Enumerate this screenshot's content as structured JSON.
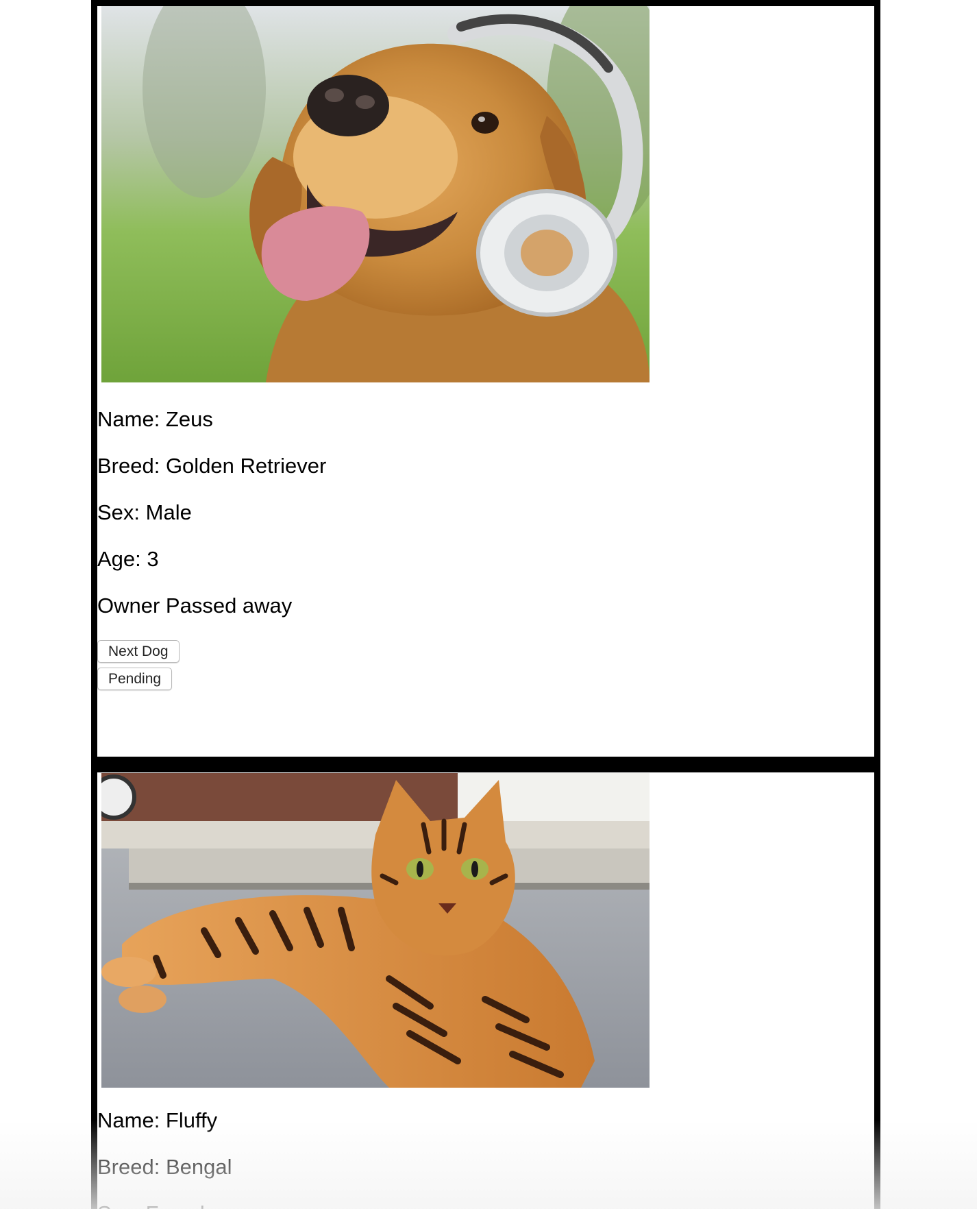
{
  "pets": [
    {
      "kind": "dog",
      "image_label": "golden retriever wearing headphones",
      "name_line": "Name: Zeus",
      "breed_line": "Breed: Golden Retriever",
      "sex_line": "Sex: Male",
      "age_line": "Age: 3",
      "story_line": "Owner Passed away",
      "buttons": {
        "next": "Next Dog",
        "pending": "Pending"
      }
    },
    {
      "kind": "cat",
      "image_label": "bengal cat lying on pavement",
      "name_line": "Name: Fluffy",
      "breed_line": "Breed: Bengal",
      "sex_line": "Sex: Female"
    }
  ],
  "colors": {
    "card_border": "#000000",
    "background": "#ffffff"
  }
}
